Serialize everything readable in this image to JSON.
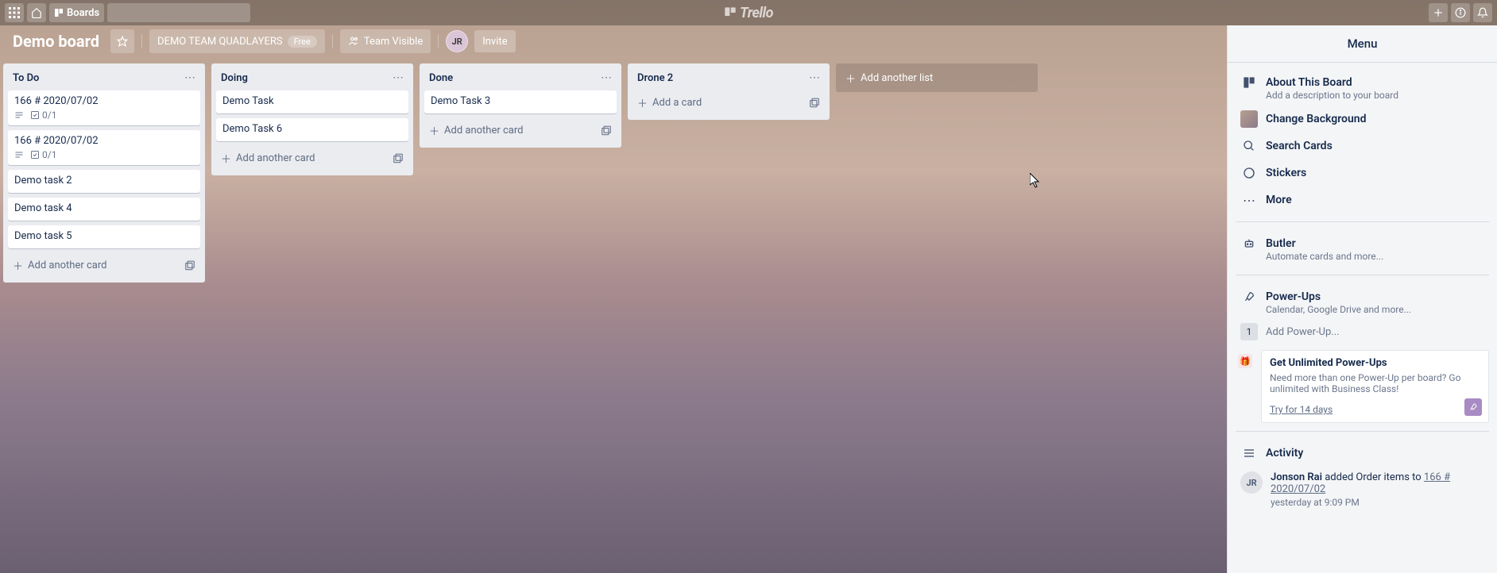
{
  "topbar": {
    "boards_label": "Boards",
    "brand": "Trello"
  },
  "board": {
    "title": "Demo board",
    "team": "DEMO TEAM QUADLAYERS",
    "free_label": "Free",
    "visibility": "Team Visible",
    "avatar": "JR",
    "invite_label": "Invite",
    "butler_label": "Butler"
  },
  "lists": [
    {
      "title": "To Do",
      "cards": [
        {
          "title": "166 # 2020/07/02",
          "has_desc": true,
          "checklist": "0/1"
        },
        {
          "title": "166 # 2020/07/02",
          "has_desc": true,
          "checklist": "0/1"
        },
        {
          "title": "Demo task 2"
        },
        {
          "title": "Demo task 4"
        },
        {
          "title": "Demo task 5"
        }
      ],
      "add_label": "Add another card"
    },
    {
      "title": "Doing",
      "cards": [
        {
          "title": "Demo Task"
        },
        {
          "title": "Demo Task 6"
        }
      ],
      "add_label": "Add another card"
    },
    {
      "title": "Done",
      "cards": [
        {
          "title": "Demo Task 3"
        }
      ],
      "add_label": "Add another card"
    },
    {
      "title": "Drone 2",
      "cards": [],
      "add_label": "Add a card"
    }
  ],
  "add_list_label": "Add another list",
  "menu": {
    "title": "Menu",
    "about": {
      "title": "About This Board",
      "sub": "Add a description to your board"
    },
    "change_bg": "Change Background",
    "search_cards": "Search Cards",
    "stickers": "Stickers",
    "more": "More",
    "butler": {
      "title": "Butler",
      "sub": "Automate cards and more..."
    },
    "powerups": {
      "title": "Power-Ups",
      "sub": "Calendar, Google Drive and more..."
    },
    "add_powerup": "Add Power-Up...",
    "powerup_count": "1",
    "promo": {
      "title": "Get Unlimited Power-Ups",
      "text": "Need more than one Power-Up per board? Go unlimited with Business Class!",
      "link": "Try for 14 days"
    },
    "activity_label": "Activity",
    "activity": [
      {
        "avatar": "JR",
        "actor": "Jonson Rai",
        "action": " added Order items to ",
        "target": "166 # 2020/07/02",
        "time": "yesterday at 9:09 PM"
      }
    ]
  }
}
